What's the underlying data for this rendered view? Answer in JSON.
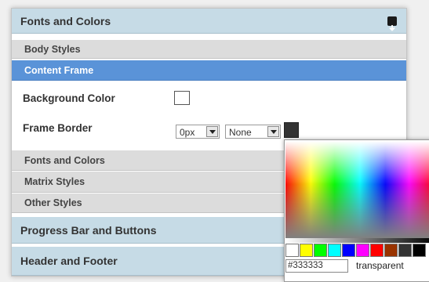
{
  "sections": {
    "fonts_colors": "Fonts and Colors",
    "progress_bar": "Progress Bar and Buttons",
    "header_footer": "Header and Footer"
  },
  "sub_items": {
    "body_styles": "Body Styles",
    "content_frame": "Content Frame",
    "fonts_colors": "Fonts and Colors",
    "matrix_styles": "Matrix Styles",
    "other_styles": "Other Styles"
  },
  "content_frame": {
    "background_color_label": "Background Color",
    "frame_border_label": "Frame Border",
    "border_width_value": "0px",
    "border_style_value": "None",
    "border_color": "#333333"
  },
  "color_picker": {
    "hex_value": "#333333",
    "transparent_label": "transparent",
    "swatches": [
      "#ffffff",
      "#ffff00",
      "#00ff00",
      "#00ffff",
      "#0000ff",
      "#ff00ff",
      "#ff0000",
      "#993300",
      "#333333",
      "#000000"
    ]
  },
  "colors": {
    "section_header_bg": "#c6dbe6",
    "active_item_bg": "#5a93d8",
    "sub_item_bg": "#dcdcdc"
  }
}
